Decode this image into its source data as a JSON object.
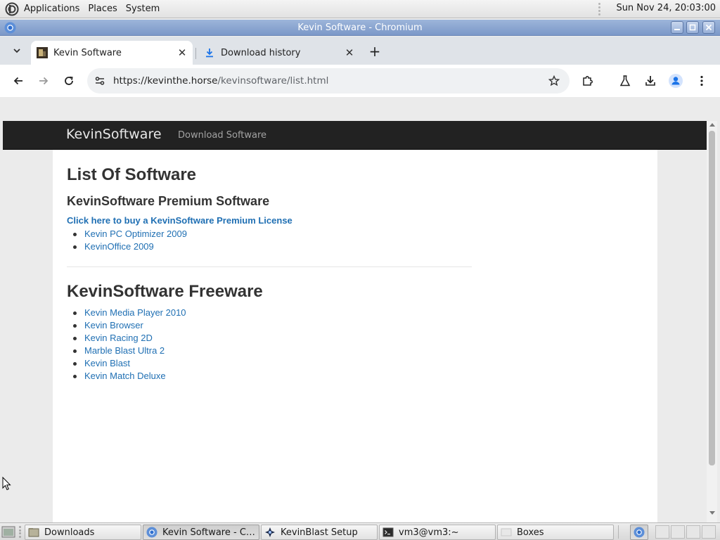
{
  "top_panel": {
    "menus": [
      "Applications",
      "Places",
      "System"
    ],
    "clock": "Sun Nov 24, 20:03:00"
  },
  "window": {
    "title": "Kevin Software - Chromium"
  },
  "tabs": [
    {
      "label": "Kevin Software",
      "active": true
    },
    {
      "label": "Download history",
      "active": false
    }
  ],
  "toolbar": {
    "url_host": "https://kevinthe.horse",
    "url_path": "/kevinsoftware/list.html"
  },
  "site": {
    "brand": "KevinSoftware",
    "nav_link": "Download Software"
  },
  "page": {
    "heading": "List Of Software",
    "premium_heading": "KevinSoftware Premium Software",
    "buy_link": "Click here to buy a KevinSoftware Premium License",
    "premium_items": [
      "Kevin PC Optimizer 2009",
      "KevinOffice 2009"
    ],
    "freeware_heading": "KevinSoftware Freeware",
    "freeware_items": [
      "Kevin Media Player 2010",
      "Kevin Browser",
      "Kevin Racing 2D",
      "Marble Blast Ultra 2",
      "Kevin Blast",
      "Kevin Match Deluxe"
    ]
  },
  "taskbar": {
    "tasks": [
      {
        "label": "Downloads",
        "icon": "folder-icon",
        "active": false
      },
      {
        "label": "Kevin Software - Ch...",
        "icon": "chromium-icon",
        "active": true
      },
      {
        "label": "KevinBlast Setup",
        "icon": "setup-icon",
        "active": false
      },
      {
        "label": "vm3@vm3:~",
        "icon": "terminal-icon",
        "active": false
      },
      {
        "label": "Boxes",
        "icon": "boxes-icon",
        "active": false
      }
    ]
  },
  "colors": {
    "link": "#1f6fb3",
    "navbar": "#222222",
    "titlebar": "#7b98c8",
    "profile_accent": "#1a73e8"
  }
}
